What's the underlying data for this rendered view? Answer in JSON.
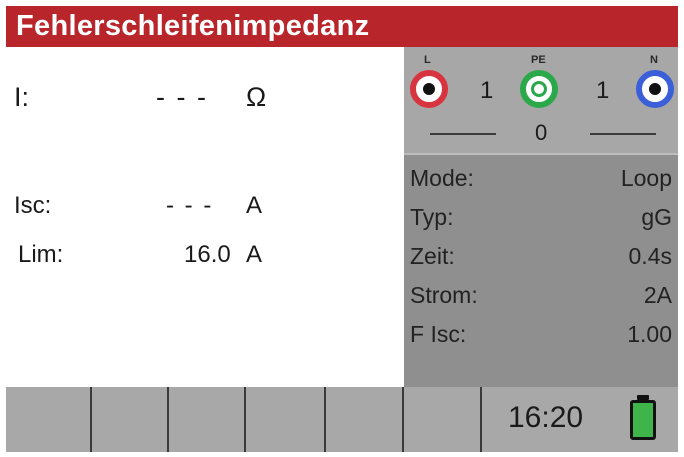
{
  "screen": {
    "title": "Fehlerschleifenimpedanz"
  },
  "measurement": {
    "impedance": {
      "label": "I:",
      "value": "- - -",
      "unit": "Ω"
    },
    "isc": {
      "label": "Isc:",
      "value": "- - -",
      "unit": "A"
    },
    "lim": {
      "label": "Lim:",
      "value": "16.0",
      "unit": "A"
    }
  },
  "terminals": {
    "items": [
      {
        "label": "L",
        "color": "#d8343f"
      },
      {
        "label": "PE",
        "color": "#2aa84a"
      },
      {
        "label": "N",
        "color": "#3a5fd8"
      }
    ],
    "l_pe": "1",
    "pe_n": "1",
    "l_n": "0"
  },
  "settings": [
    {
      "key": "Mode:",
      "value": "Loop"
    },
    {
      "key": "Typ:",
      "value": "gG"
    },
    {
      "key": "Zeit:",
      "value": "0.4s"
    },
    {
      "key": "Strom:",
      "value": "2A"
    },
    {
      "key": "F Isc:",
      "value": "1.00"
    }
  ],
  "status_bar": {
    "time": "16:20",
    "battery_level": 1.0,
    "battery_color": "#3fb44a"
  }
}
